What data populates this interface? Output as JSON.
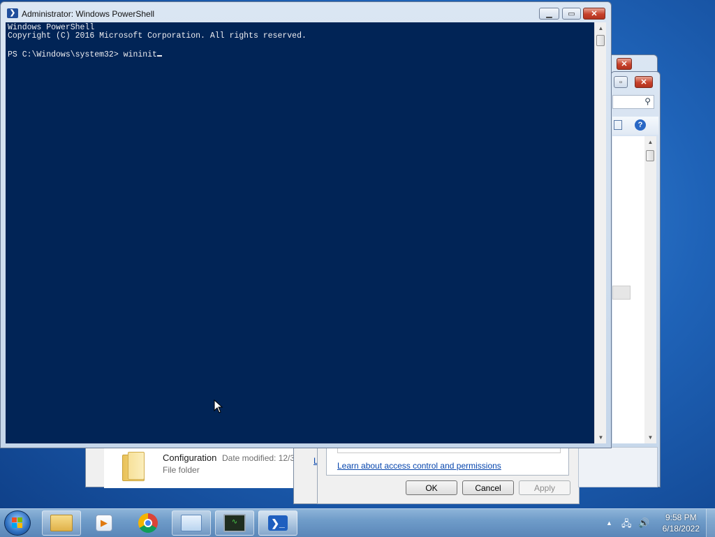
{
  "powershell": {
    "title": "Administrator: Windows PowerShell",
    "icon": "powershell-icon",
    "lines": [
      "Windows PowerShell",
      "Copyright (C) 2016 Microsoft Corporation. All rights reserved.",
      ""
    ],
    "prompt": "PS C:\\Windows\\system32> ",
    "command": "wininit"
  },
  "explorer_item": {
    "name": "Configuration",
    "date_label": "Date modified: 12/3",
    "type": "File folder",
    "icon": "folder-icon"
  },
  "security_dialog": {
    "link_text": "Learn about access control and permissions",
    "ok_label": "OK",
    "cancel_label": "Cancel",
    "apply_label": "Apply",
    "partial_link": "L"
  },
  "taskbar": {
    "start_icon": "windows-start-icon",
    "apps": [
      "file-explorer-icon",
      "media-player-icon",
      "chrome-icon",
      "control-panel-icon",
      "task-manager-icon",
      "powershell-icon"
    ],
    "time": "9:58 PM",
    "date": "6/18/2022"
  },
  "colors": {
    "console_bg": "#012456",
    "console_fg": "#eeedf0",
    "link": "#0645ad"
  }
}
